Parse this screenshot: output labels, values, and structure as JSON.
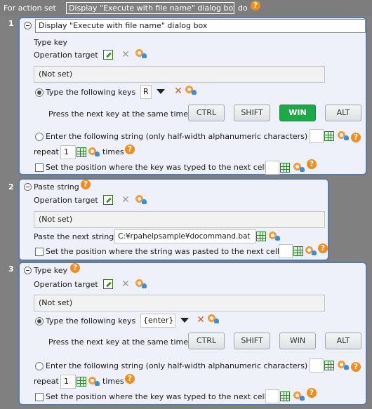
{
  "header": {
    "prefix": "For action set",
    "set_name": "Display \"Execute with file name\" dialog box",
    "suffix": "do"
  },
  "icons": {
    "help": "?",
    "x": "✕",
    "help_icon": "question-circle-icon",
    "edit_icon": "pencil-square-icon",
    "delete_icon": "x-icon",
    "pick_icon": "target-person-icon",
    "cell_icon": "spreadsheet-grid-icon"
  },
  "blocks": [
    {
      "number": "1",
      "title_value": "Display \"Execute with file name\" dialog box",
      "type_label": "Type key",
      "operation_target": "Operation target",
      "target_value": "(Not set)",
      "radio_keys_label": "Type the following keys",
      "key_value": "R",
      "press_label": "Press the next key at the same time",
      "keys": [
        "CTRL",
        "SHIFT",
        "WIN",
        "ALT"
      ],
      "radio_string_label": "Enter the following string (only half-width alphanumeric characters)",
      "repeat_label": "repeat",
      "repeat_value": "1",
      "times_label": "times",
      "check_label": "Set the position where the key was typed to the next cell"
    },
    {
      "number": "2",
      "type_label": "Paste string",
      "operation_target": "Operation target",
      "target_value": "(Not set)",
      "paste_label": "Paste the next string",
      "paste_value": "C:¥rpahelpsample¥docommand.bat",
      "check_label": "Set the position where the string was pasted to the next cell"
    },
    {
      "number": "3",
      "type_label": "Type key",
      "operation_target": "Operation target",
      "target_value": "(Not set)",
      "radio_keys_label": "Type the following keys",
      "key_value": "{enter}",
      "press_label": "Press the next key at the same time",
      "keys": [
        "CTRL",
        "SHIFT",
        "WIN",
        "ALT"
      ],
      "radio_string_label": "Enter the following string (only half-width alphanumeric characters)",
      "repeat_label": "repeat",
      "repeat_value": "1",
      "times_label": "times",
      "check_label": "Set the position where the key was typed to the next cell"
    }
  ],
  "colors": {
    "header_bg": "#7d7d7d",
    "block_border": "#5b7aa6",
    "block_bg": "#eef1f9",
    "active_key": "#1ea84a",
    "help_orange": "#f28c1a"
  }
}
